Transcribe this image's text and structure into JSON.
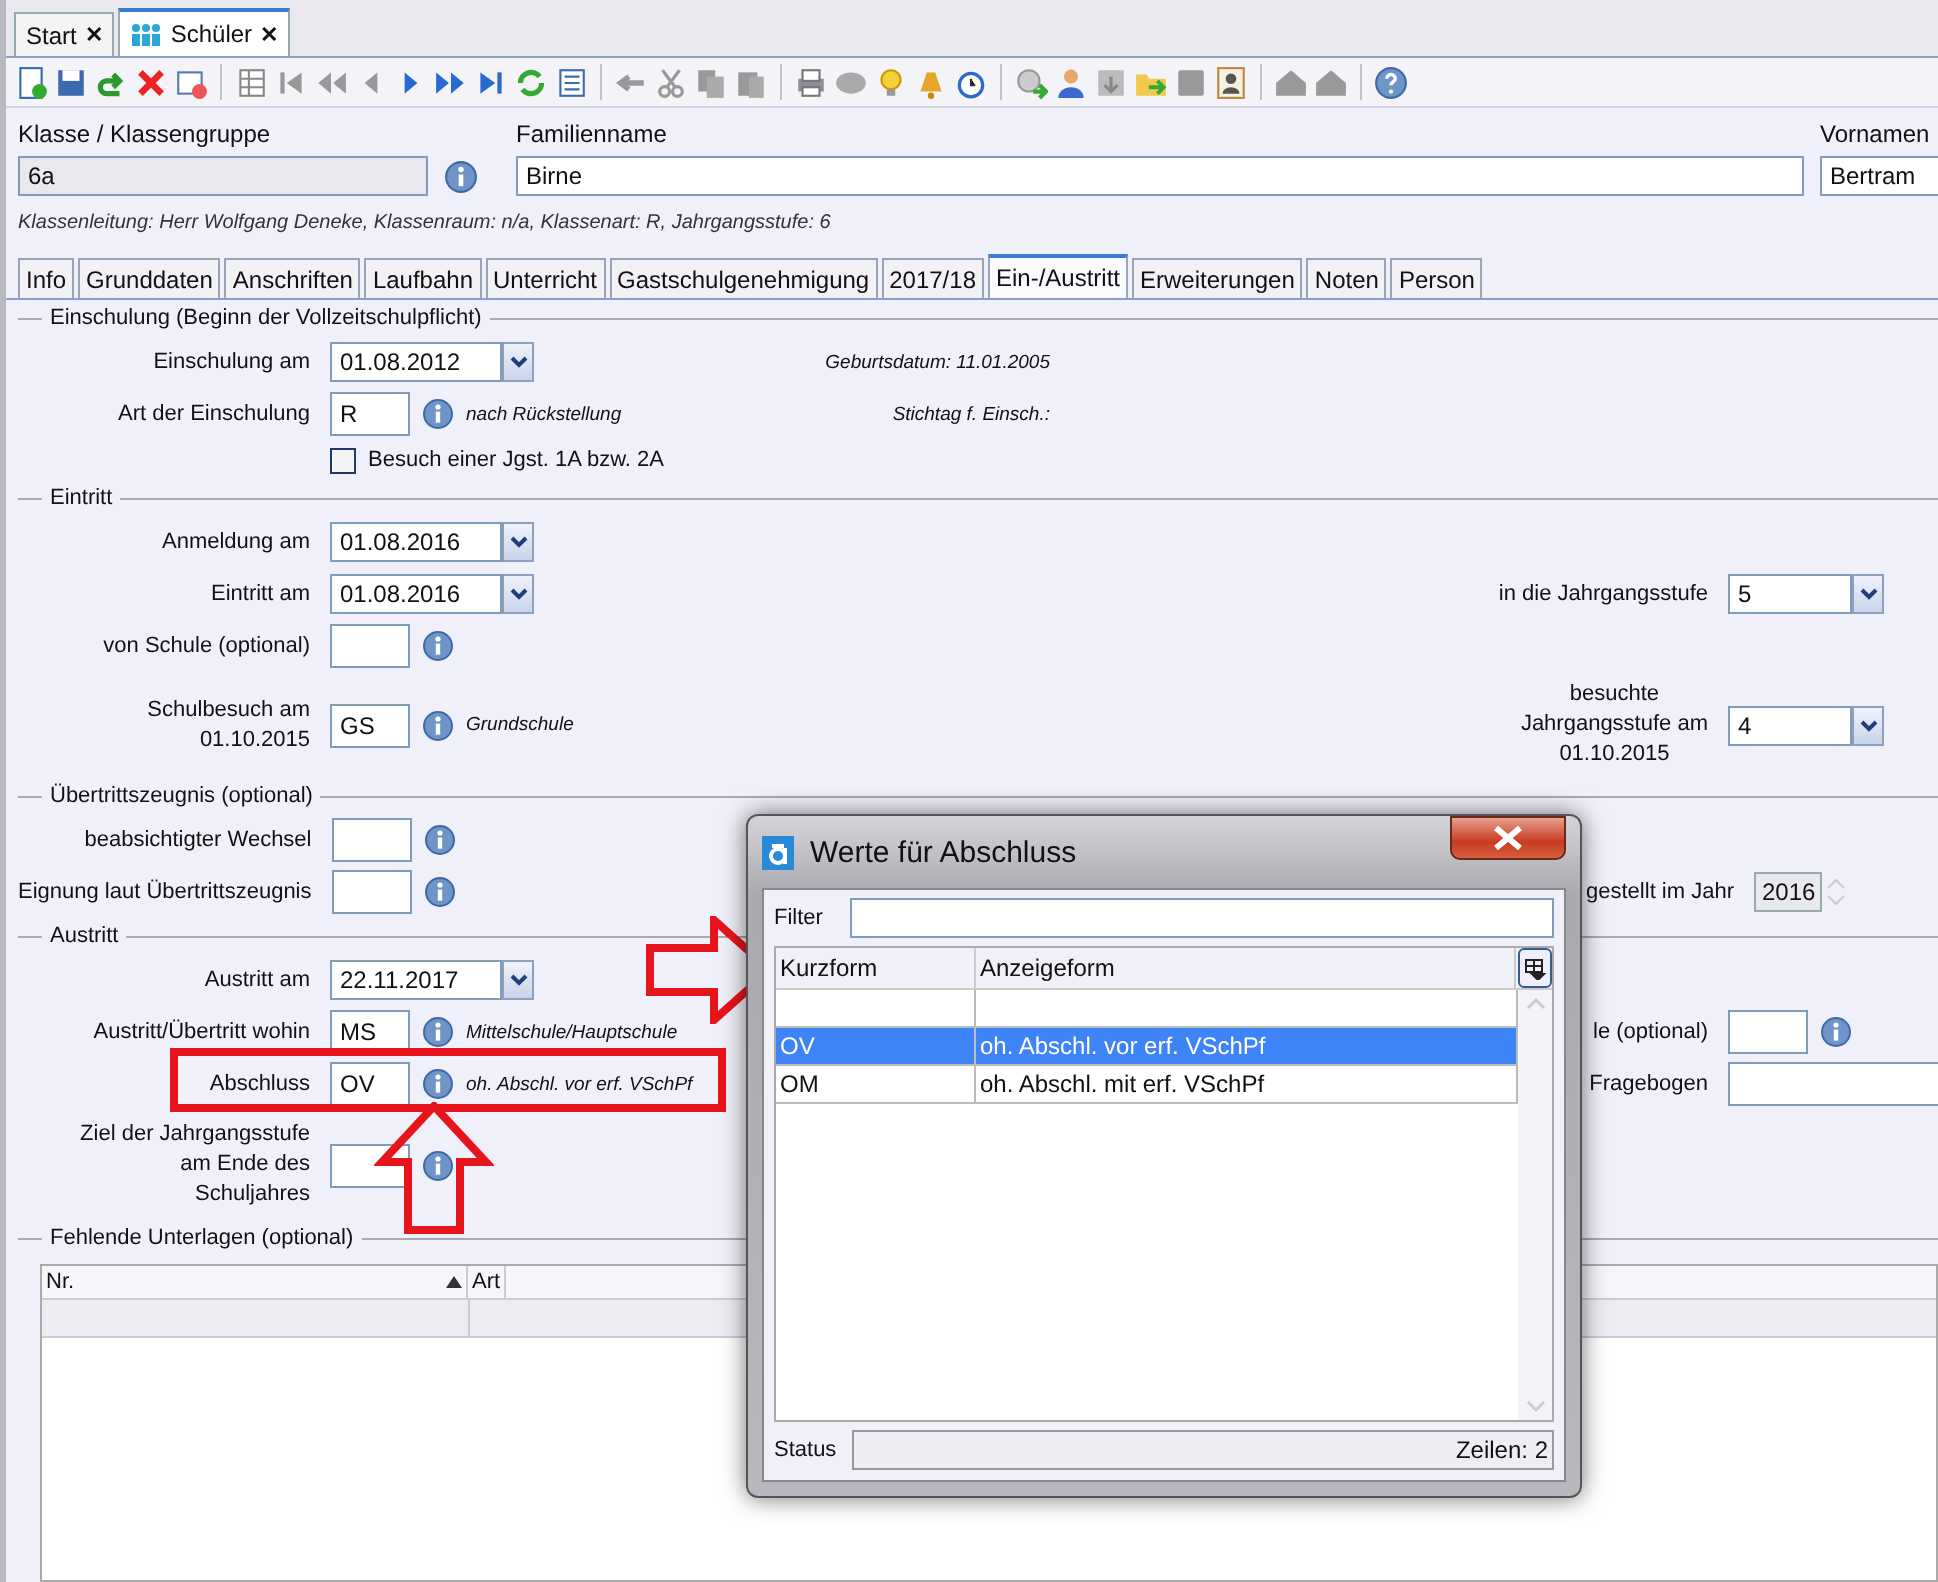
{
  "doc_tabs": [
    {
      "label": "Start",
      "selected": false,
      "close_mark": "✕"
    },
    {
      "label": "Schüler",
      "selected": true,
      "close_mark": "✕"
    }
  ],
  "header": {
    "class_label": "Klasse / Klassengruppe",
    "class_value": "6a",
    "surname_label": "Familienname",
    "surname_value": "Birne",
    "firstname_label": "Vornamen",
    "firstname_value": "Bertram",
    "info_line": "Klassenleitung: Herr Wolfgang Deneke, Klassenraum: n/a, Klassenart: R, Jahrgangsstufe: 6"
  },
  "tabs": [
    {
      "label": "Info",
      "selected": false
    },
    {
      "label": "Grunddaten",
      "selected": false
    },
    {
      "label": "Anschriften",
      "selected": false
    },
    {
      "label": "Laufbahn",
      "selected": false
    },
    {
      "label": "Unterricht",
      "selected": false
    },
    {
      "label": "Gastschulgenehmigung",
      "selected": false
    },
    {
      "label": "2017/18",
      "selected": false
    },
    {
      "label": "Ein-/Austritt",
      "selected": true
    },
    {
      "label": "Erweiterungen",
      "selected": false
    },
    {
      "label": "Noten",
      "selected": false
    },
    {
      "label": "Person",
      "selected": false
    }
  ],
  "sections": [
    {
      "title": "Einschulung (Beginn der Vollzeitschulpflicht)",
      "rows": [
        {
          "kind": "date",
          "label": "Einschulung am",
          "value": "01.08.2012",
          "note": "Geburtsdatum: 11.01.2005"
        },
        {
          "kind": "code",
          "label": "Art der Einschulung",
          "value": "R",
          "hint": "nach Rückstellung",
          "note": "Stichtag f. Einsch.:"
        },
        {
          "kind": "checkbox",
          "text": "Besuch einer Jgst. 1A bzw. 2A",
          "checked": false
        }
      ]
    },
    {
      "title": "Eintritt",
      "rows": [
        {
          "kind": "date",
          "label": "Anmeldung am",
          "value": "01.08.2016"
        },
        {
          "kind": "date",
          "label": "Eintritt am",
          "value": "01.08.2016",
          "right": {
            "kind": "combo",
            "label": "in die Jahrgangsstufe",
            "value": "5"
          }
        },
        {
          "kind": "code",
          "label": "von Schule (optional)"
        },
        {
          "kind": "code",
          "label": "Schulbesuch am\n01.10.2015",
          "value": "GS",
          "hint": "Grundschule",
          "right": {
            "kind": "combo",
            "label": "besuchte\nJahrgangsstufe am\n01.10.2015",
            "value": "4"
          }
        }
      ]
    },
    {
      "title": "Übertrittszeugnis (optional)",
      "rows": [
        {
          "kind": "code",
          "label": "beabsichtigter Wechsel"
        },
        {
          "kind": "code",
          "label": "Eignung laut Übertrittszeugnis",
          "right": {
            "kind": "spinner",
            "label": "gestellt im Jahr",
            "value": "2016"
          }
        }
      ]
    },
    {
      "title": "Austritt",
      "rows": [
        {
          "kind": "date",
          "label": "Austritt am",
          "value": "22.11.2017"
        },
        {
          "kind": "code",
          "label": "Austritt/Übertritt wohin",
          "value": "MS",
          "hint": "Mittelschule/Hauptschule",
          "right": {
            "kind": "code",
            "label": "le (optional)"
          }
        },
        {
          "kind": "code",
          "label": "Abschluss",
          "value": "OV",
          "hint": "oh. Abschl. vor erf. VSchPf",
          "right": {
            "kind": "text",
            "label": "Fragebogen"
          }
        },
        {
          "kind": "code",
          "label": "Ziel der Jahrgangsstufe\nam Ende des\nSchuljahres"
        }
      ]
    }
  ],
  "missing_documents": {
    "title": "Fehlende Unterlagen (optional)",
    "columns": [
      {
        "label": "Nr.",
        "sorted": true
      },
      {
        "label": "Art",
        "sorted": false
      }
    ]
  },
  "dialog": {
    "title": "Werte für Abschluss",
    "filter_label": "Filter",
    "columns": [
      "Kurzform",
      "Anzeigeform"
    ],
    "rows": [
      {
        "code": "OV",
        "text": "oh. Abschl. vor erf. VSchPf",
        "selected": true
      },
      {
        "code": "OM",
        "text": "oh. Abschl. mit erf. VSchPf",
        "selected": false
      }
    ],
    "status_label": "Status",
    "status_text": "Zeilen: 2"
  }
}
